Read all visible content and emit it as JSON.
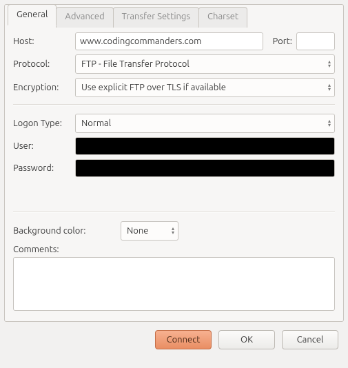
{
  "tabs": {
    "general": "General",
    "advanced": "Advanced",
    "transfer": "Transfer Settings",
    "charset": "Charset"
  },
  "form": {
    "host_label": "Host:",
    "host_value": "www.codingcommanders.com",
    "port_label": "Port:",
    "port_value": "",
    "protocol_label": "Protocol:",
    "protocol_value": "FTP - File Transfer Protocol",
    "encryption_label": "Encryption:",
    "encryption_value": "Use explicit FTP over TLS if available",
    "logon_type_label": "Logon Type:",
    "logon_type_value": "Normal",
    "user_label": "User:",
    "user_value": "",
    "password_label": "Password:",
    "password_value": "",
    "bgcolor_label": "Background color:",
    "bgcolor_value": "None",
    "comments_label": "Comments:",
    "comments_value": ""
  },
  "buttons": {
    "connect": "Connect",
    "ok": "OK",
    "cancel": "Cancel"
  }
}
